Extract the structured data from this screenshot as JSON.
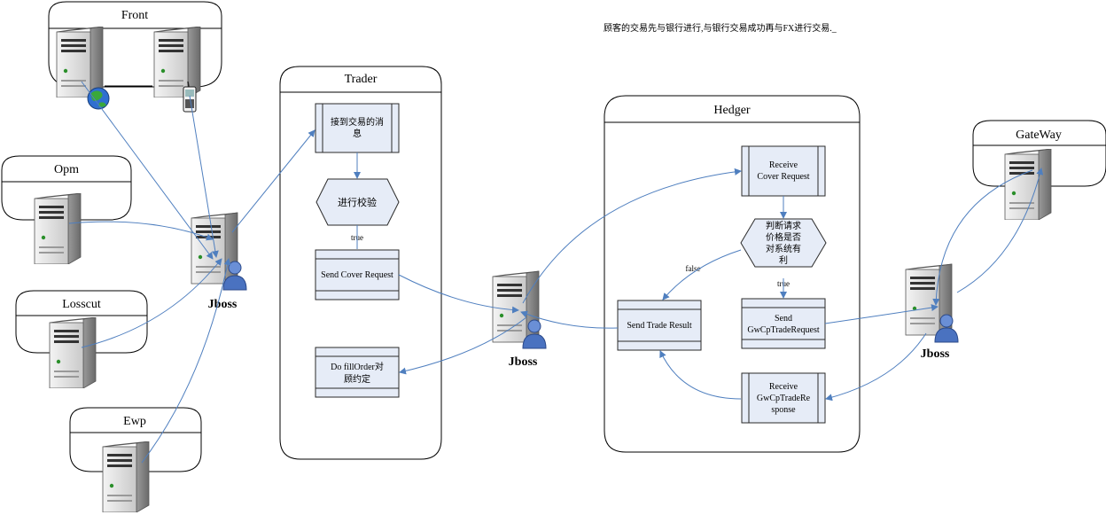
{
  "note": "顾客的交易先与银行进行,与银行交易成功再与FX进行交易._",
  "containers": {
    "front": "Front",
    "opm": "Opm",
    "losscut": "Losscut",
    "ewp": "Ewp",
    "trader": "Trader",
    "hedger": "Hedger",
    "gateway": "GateWay"
  },
  "servers": {
    "jboss_left": "Jboss",
    "jboss_mid": "Jboss",
    "jboss_right": "Jboss"
  },
  "trader": {
    "receive_msg": [
      "接到交易的消",
      "息"
    ],
    "validate": "进行校验",
    "true_label": "true",
    "send_cover": "Send Cover Request",
    "fill_order": [
      "Do fillOrder对",
      "顾约定"
    ]
  },
  "hedger": {
    "receive_cover": [
      "Receive",
      "Cover Request"
    ],
    "judge": [
      "判断请求",
      "价格是否",
      "对系统有",
      "利"
    ],
    "false_label": "false",
    "true_label": "true",
    "send_trade_result": "Send Trade Result",
    "send_gwcp": [
      "Send",
      "GwCpTradeRequest"
    ],
    "receive_gwcp": [
      "Receive",
      "GwCpTradeRe",
      "sponse"
    ]
  }
}
